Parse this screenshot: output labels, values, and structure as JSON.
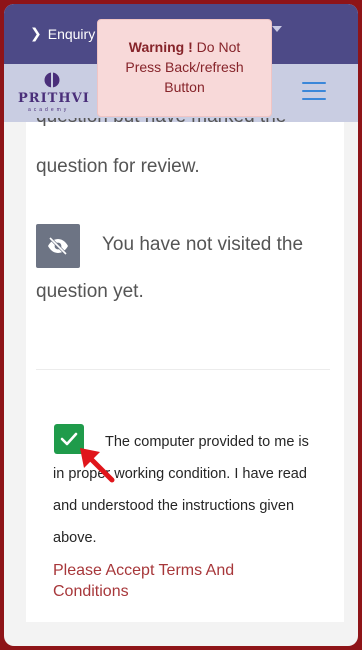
{
  "header": {
    "enquiry_label": "Enquiry"
  },
  "logo": {
    "wordmark": "PRITHVI",
    "subtext": "academy"
  },
  "warning": {
    "bold": "Warning !",
    "text": " Do Not Press Back/refresh Button"
  },
  "legend": {
    "marked_review_clipped": "question but have marked the",
    "marked_review_line2": "question for review.",
    "not_visited_line1": "You have not visited the",
    "not_visited_line2": "question yet."
  },
  "terms": {
    "checked": true,
    "text": "The computer provided to me is in proper working condition. I have read and understood the instructions given above.",
    "error": "Please Accept Terms And Conditions"
  },
  "colors": {
    "outer_border": "#8e1418",
    "topbar": "#4d4a87",
    "navbar": "#c9cde2",
    "warning_bg": "#f8d9d9",
    "warning_text": "#86242a",
    "checkbox": "#1f9b4b",
    "error_text": "#a7373a",
    "eye_box": "#6d7484",
    "hamburger": "#3b87d9"
  },
  "icons": {
    "enquiry": "chevron-right-icon",
    "dropdown": "caret-down-icon",
    "menu": "hamburger-menu-icon",
    "not_visited": "eye-slash-icon",
    "checkbox": "checkmark-icon",
    "pointer": "red-arrow-icon"
  }
}
